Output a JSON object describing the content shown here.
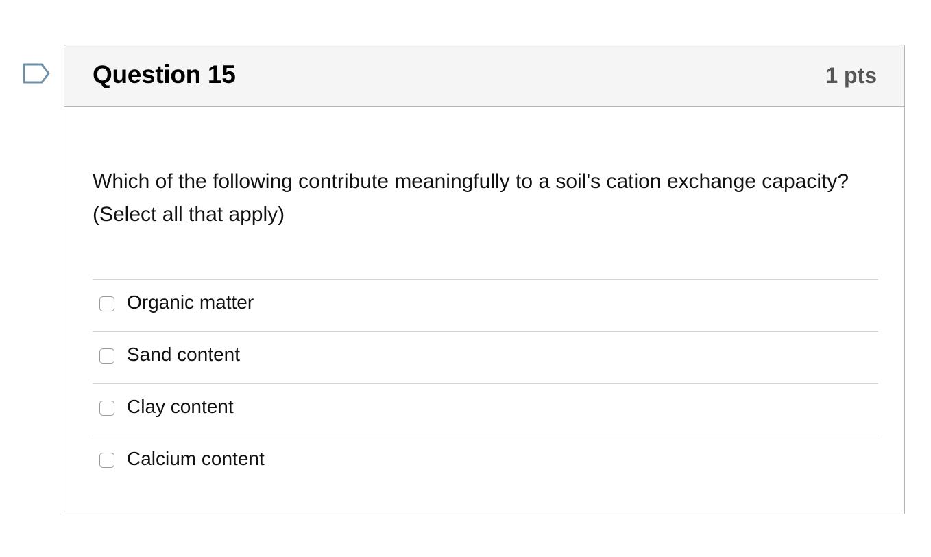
{
  "question": {
    "title": "Question 15",
    "points": "1 pts",
    "text": "Which of the following contribute meaningfully to a soil's cation exchange capacity? (Select all that apply)"
  },
  "answers": [
    {
      "label": "Organic matter",
      "checked": false
    },
    {
      "label": "Sand content",
      "checked": false
    },
    {
      "label": "Clay content",
      "checked": false
    },
    {
      "label": "Calcium content",
      "checked": false
    }
  ],
  "colors": {
    "flag": "#6f8fa6",
    "header_bg": "#f5f5f5",
    "border": "#b4b4b4"
  },
  "icons": {
    "flag": "bookmark-flag-icon",
    "checkbox": "checkbox-icon"
  }
}
